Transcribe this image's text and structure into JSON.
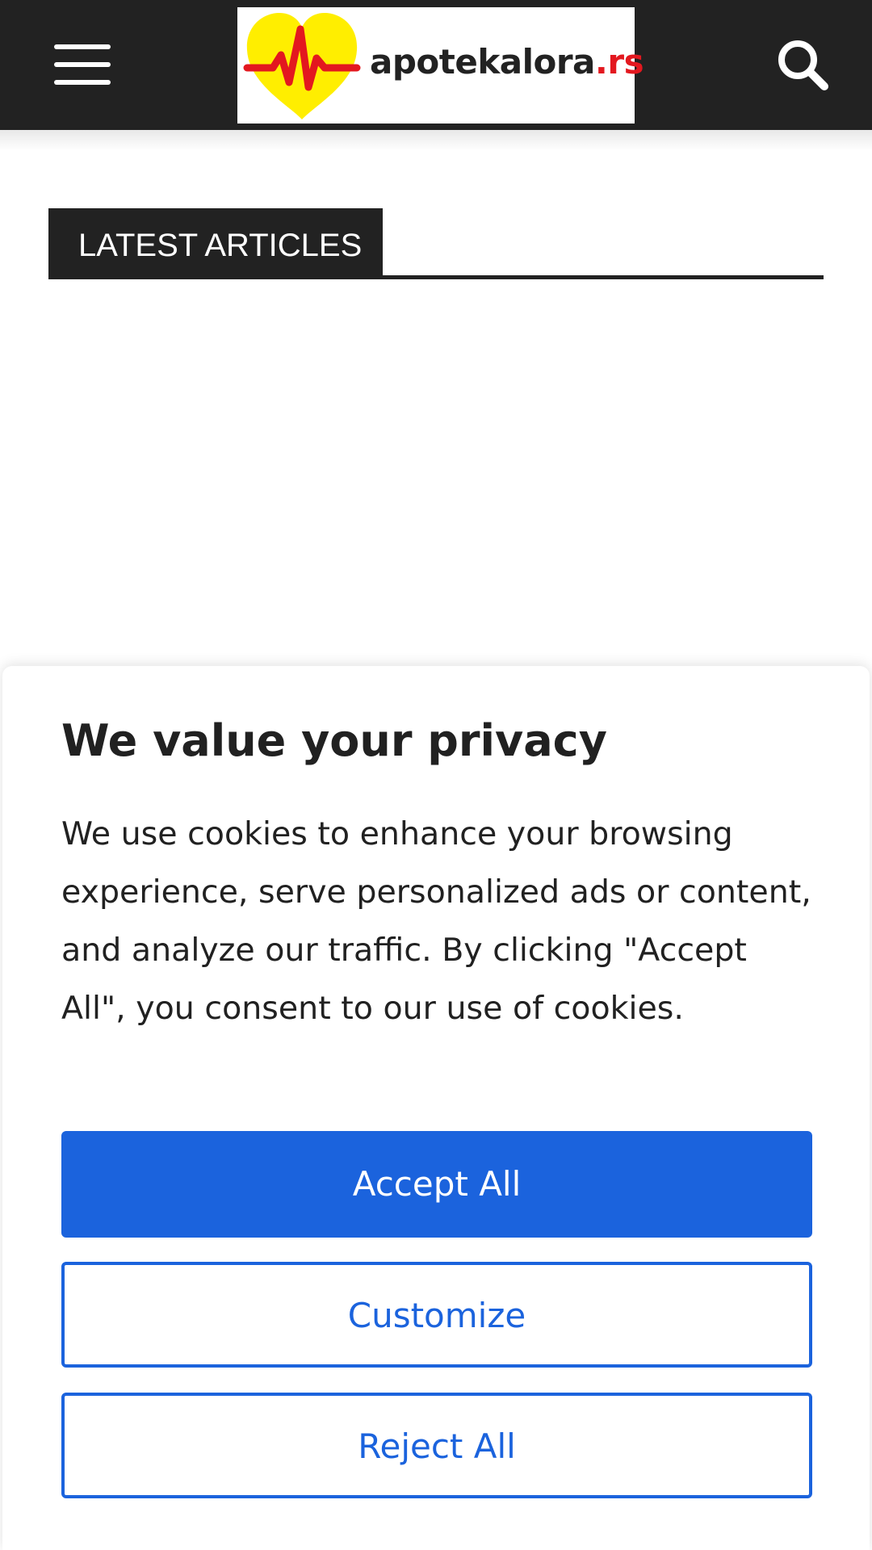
{
  "header": {
    "background_color": "#222222",
    "menu_icon": "hamburger-menu-icon",
    "logo": {
      "text": "apotekalora",
      "tld": ".rs",
      "icon": "heart-heartbeat-icon",
      "heart_color": "#ffee00",
      "pulse_color": "#e3181f"
    },
    "search_icon": "search-icon"
  },
  "main": {
    "block_title": "LATEST ARTICLES"
  },
  "consent": {
    "title": "We value your privacy",
    "body": "We use cookies to enhance your browsing experience, serve personalized ads or content, and analyze our traffic. By clicking \"Accept All\", you consent to our use of cookies.",
    "buttons": {
      "accept": "Accept All",
      "customize": "Customize",
      "reject": "Reject All"
    },
    "accent_color": "#1b63dd"
  }
}
